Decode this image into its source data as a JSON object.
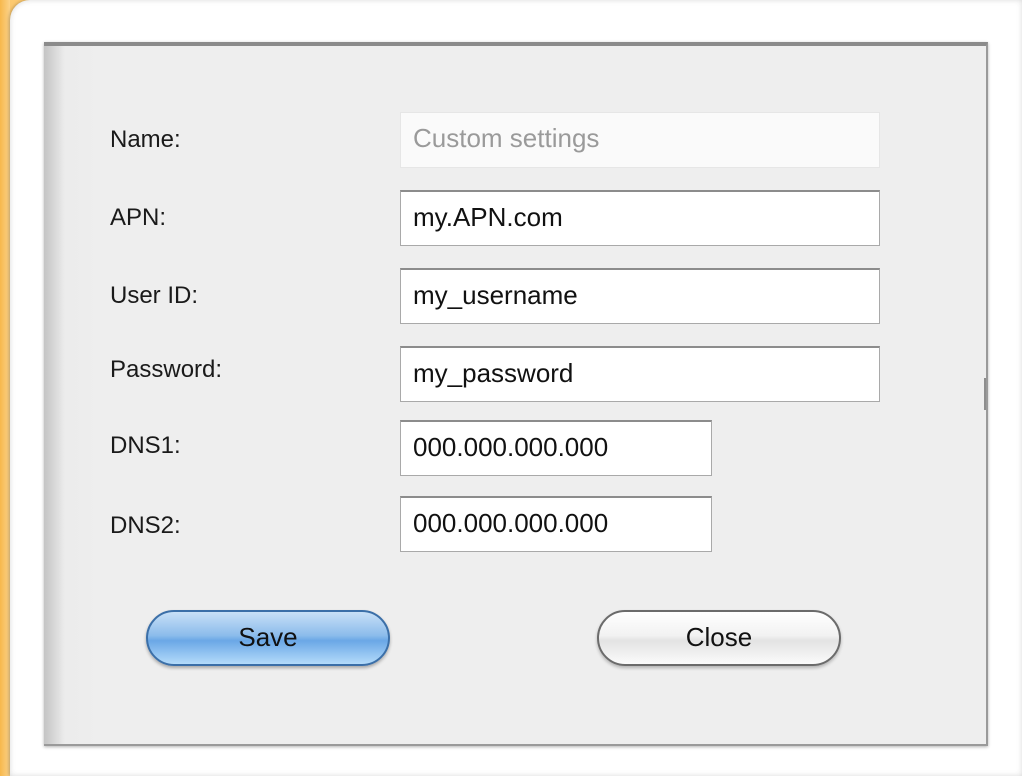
{
  "form": {
    "name": {
      "label": "Name:",
      "value": "Custom settings"
    },
    "apn": {
      "label": "APN:",
      "value": "my.APN.com"
    },
    "user_id": {
      "label": "User ID:",
      "value": "my_username"
    },
    "password": {
      "label": "Password:",
      "value": "my_password"
    },
    "dns1": {
      "label": "DNS1:",
      "value": "000.000.000.000"
    },
    "dns2": {
      "label": "DNS2:",
      "value": "000.000.000.000"
    }
  },
  "buttons": {
    "save_label": "Save",
    "close_label": "Close"
  },
  "colors": {
    "accent_save": "#6aa7e6",
    "background_left_strip": "#fcc96f",
    "dialog_background": "#eeeeee"
  }
}
